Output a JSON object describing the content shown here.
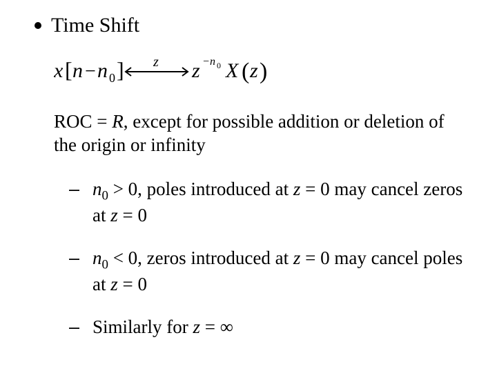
{
  "title": "Time Shift",
  "formula": {
    "lhs_var": "x",
    "lhs_arg_a": "n",
    "lhs_arg_op": "−",
    "lhs_arg_b": "n",
    "lhs_arg_b_sub": "0",
    "arrow_top": "z",
    "rhs_base": "z",
    "rhs_exp_sign": "−",
    "rhs_exp_var": "n",
    "rhs_exp_sub": "0",
    "rhs_fun": "X",
    "rhs_arg": "z"
  },
  "roc": {
    "prefix": "ROC = ",
    "R": "R",
    "suffix": ", except for possible addition or deletion of the origin or infinity"
  },
  "items": [
    {
      "n": "n",
      "nsub": "0",
      "cmp": " > 0, poles introduced at  ",
      "z1": "z",
      "mid": " = 0 may cancel zeros at ",
      "z2": "z",
      "tail": " = 0"
    },
    {
      "n": "n",
      "nsub": "0",
      "cmp": " < 0, zeros introduced at  ",
      "z1": "z",
      "mid": " = 0 may cancel poles at ",
      "z2": "z",
      "tail": " = 0"
    },
    {
      "plain_a": "Similarly for  ",
      "z": "z",
      "plain_b": " = ∞"
    }
  ]
}
